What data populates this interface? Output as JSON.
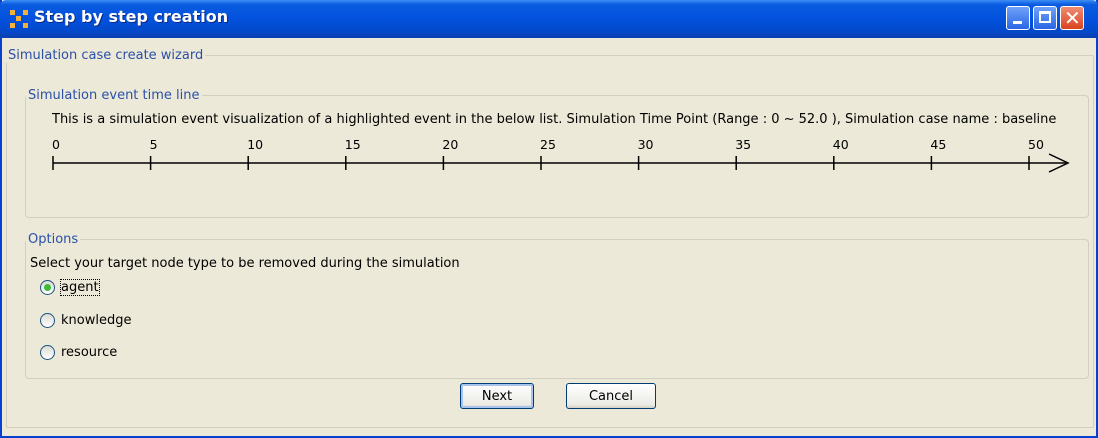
{
  "window": {
    "title": "Step by step creation",
    "buttons": [
      "minimize",
      "maximize",
      "close"
    ]
  },
  "wizard": {
    "legend": "Simulation case create wizard"
  },
  "timeline": {
    "legend": "Simulation event time line",
    "description": "This is a simulation event visualization of a highlighted event in the below list. Simulation Time Point (Range : 0 ~ 52.0 ), Simulation case name : baseline",
    "range": [
      0,
      52.0
    ],
    "ticks": [
      "0",
      "5",
      "10",
      "15",
      "20",
      "25",
      "30",
      "35",
      "40",
      "45",
      "50"
    ]
  },
  "options": {
    "legend": "Options",
    "instruction": "Select your target node type to be removed during the simulation",
    "choices": [
      {
        "label": "agent",
        "selected": true
      },
      {
        "label": "knowledge",
        "selected": false
      },
      {
        "label": "resource",
        "selected": false
      }
    ]
  },
  "buttons": {
    "next": "Next",
    "cancel": "Cancel"
  }
}
